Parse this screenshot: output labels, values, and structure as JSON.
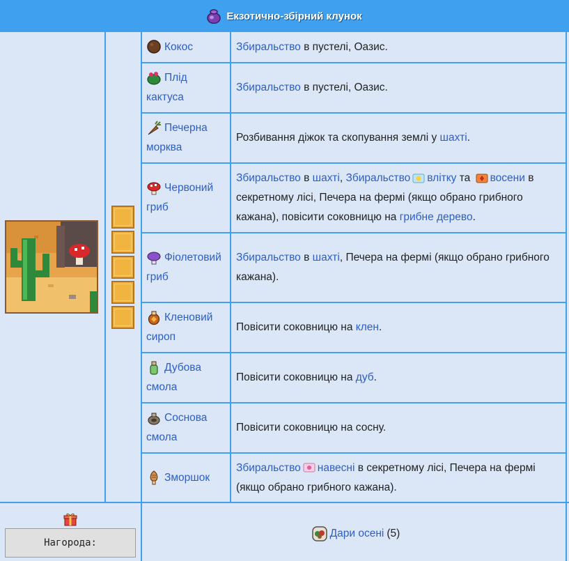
{
  "bundle": {
    "title": "Екзотично-збірний клунок",
    "icon": "purple-bundle-icon",
    "slots_required": 5
  },
  "items": [
    {
      "name": "Кокос",
      "icon": "coconut-icon",
      "source": [
        {
          "t": "link",
          "v": "Збиральство"
        },
        {
          "t": "text",
          "v": " в пустелі, Оазис."
        }
      ]
    },
    {
      "name": "Плід кактуса",
      "icon": "cactus-fruit-icon",
      "source": [
        {
          "t": "link",
          "v": "Збиральство"
        },
        {
          "t": "text",
          "v": " в пустелі, Оазис."
        }
      ]
    },
    {
      "name": "Печерна морква",
      "icon": "cave-carrot-icon",
      "source": [
        {
          "t": "text",
          "v": "Розбивання діжок та скопування землі у "
        },
        {
          "t": "link",
          "v": "шахті"
        },
        {
          "t": "text",
          "v": "."
        }
      ]
    },
    {
      "name": "Червоний гриб",
      "icon": "red-mushroom-icon",
      "source": [
        {
          "t": "link",
          "v": "Збиральство"
        },
        {
          "t": "text",
          "v": " в "
        },
        {
          "t": "link",
          "v": "шахті"
        },
        {
          "t": "text",
          "v": ", "
        },
        {
          "t": "link",
          "v": "Збиральство"
        },
        {
          "t": "icon",
          "v": "summer-icon"
        },
        {
          "t": "link",
          "v": "влітку"
        },
        {
          "t": "text",
          "v": " та "
        },
        {
          "t": "icon",
          "v": "fall-icon"
        },
        {
          "t": "link",
          "v": "восени"
        },
        {
          "t": "text",
          "v": " в секретному лісі, Печера на фермі (якщо обрано грибного кажана), повісити соковницю на "
        },
        {
          "t": "link",
          "v": "грибне дерево"
        },
        {
          "t": "text",
          "v": "."
        }
      ]
    },
    {
      "name": "Фіолетовий гриб",
      "icon": "purple-mushroom-icon",
      "source": [
        {
          "t": "link",
          "v": "Збиральство"
        },
        {
          "t": "text",
          "v": " в "
        },
        {
          "t": "link",
          "v": "шахті"
        },
        {
          "t": "text",
          "v": ", Печера на фермі (якщо обрано грибного кажана)."
        }
      ]
    },
    {
      "name": "Кленовий сироп",
      "icon": "maple-syrup-icon",
      "source": [
        {
          "t": "text",
          "v": "Повісити соковницю на "
        },
        {
          "t": "link",
          "v": "клен"
        },
        {
          "t": "text",
          "v": "."
        }
      ]
    },
    {
      "name": "Дубова смола",
      "icon": "oak-resin-icon",
      "source": [
        {
          "t": "text",
          "v": "Повісити соковницю на "
        },
        {
          "t": "link",
          "v": "дуб"
        },
        {
          "t": "text",
          "v": "."
        }
      ]
    },
    {
      "name": "Соснова смола",
      "icon": "pine-tar-icon",
      "source": [
        {
          "t": "text",
          "v": "Повісити соковницю на сосну."
        }
      ]
    },
    {
      "name": "Зморшок",
      "icon": "morel-icon",
      "source": [
        {
          "t": "link",
          "v": "Збиральство"
        },
        {
          "t": "icon",
          "v": "spring-icon"
        },
        {
          "t": "link",
          "v": "навесні"
        },
        {
          "t": "text",
          "v": " в секретному лісі, Печера на фермі (якщо обрано грибного кажана)."
        }
      ]
    }
  ],
  "reward": {
    "label": "Нагорода:",
    "icon": "gift-icon",
    "item_icon": "fall-seeds-icon",
    "item_link": "Дари осені",
    "qty": "(5)"
  }
}
